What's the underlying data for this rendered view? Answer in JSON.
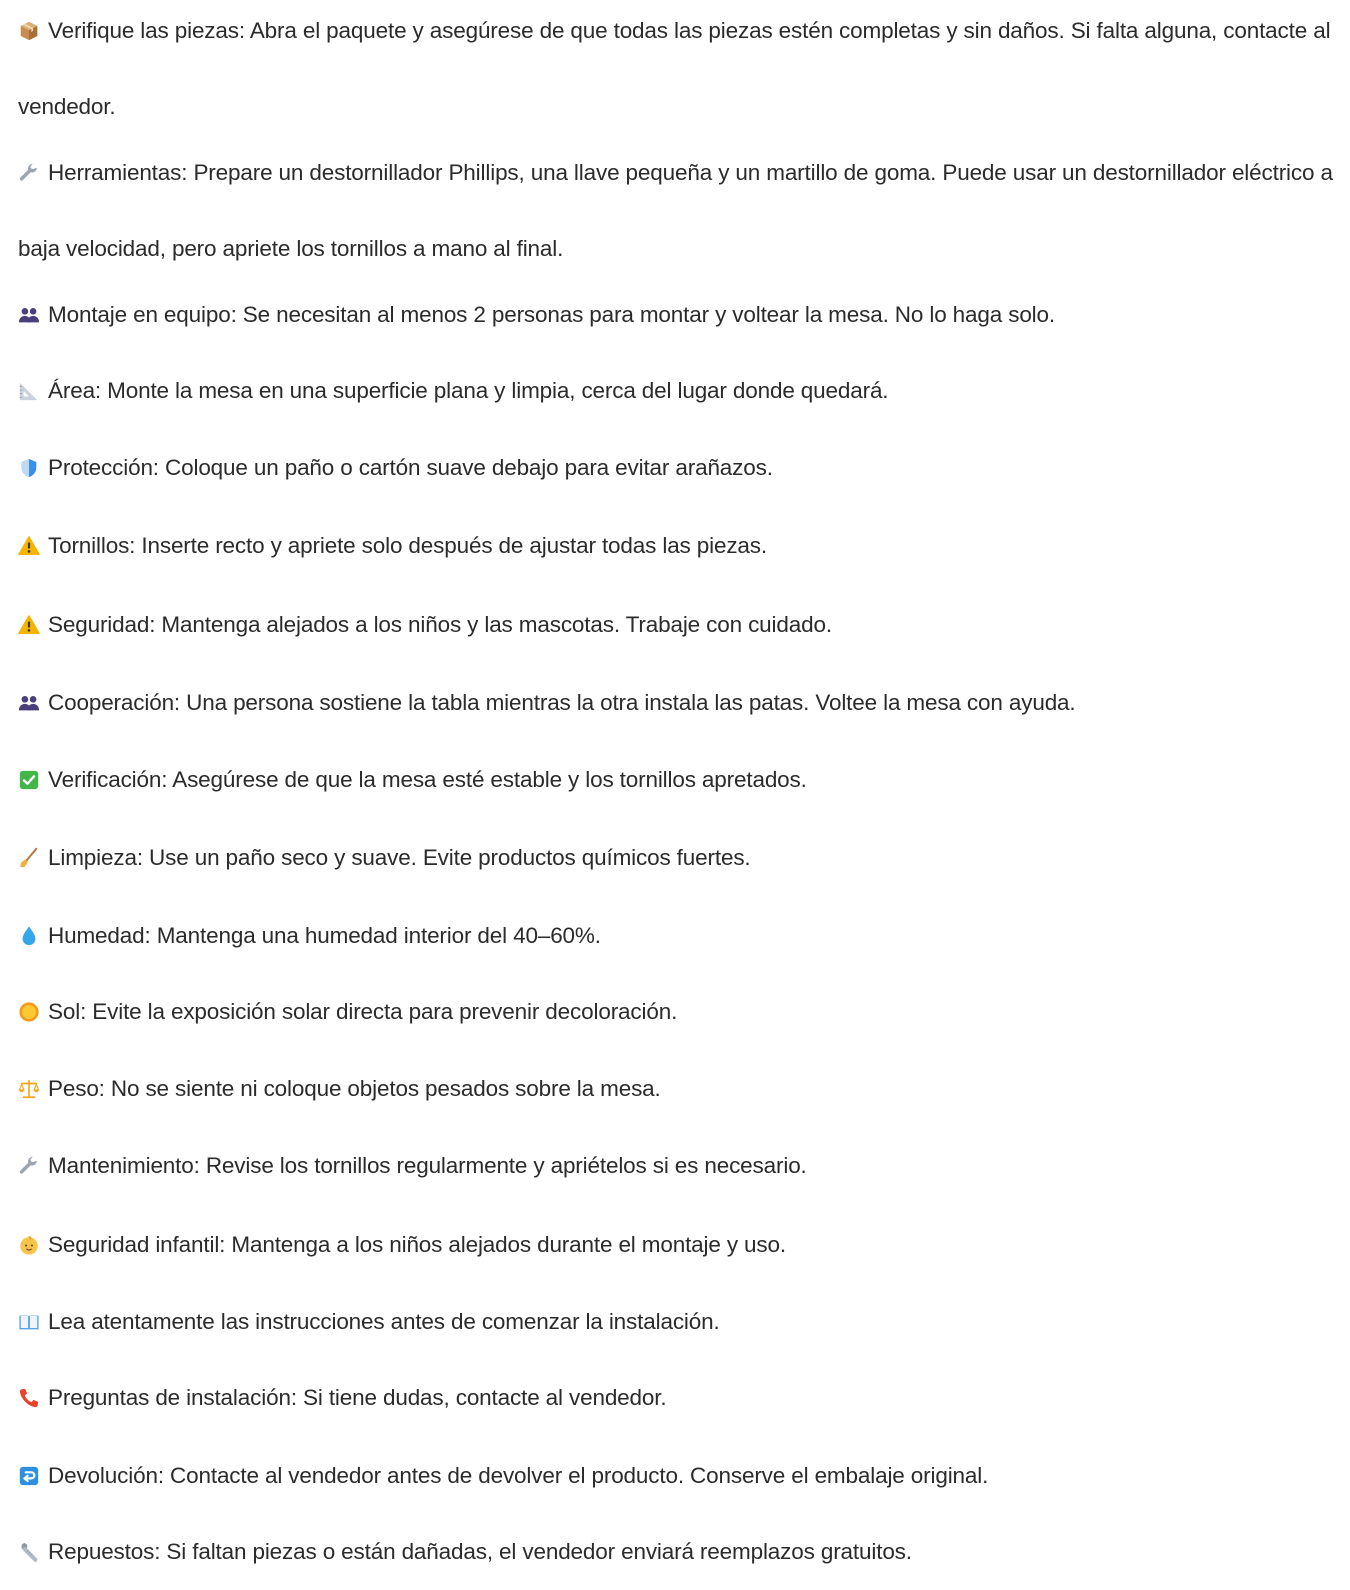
{
  "items": [
    {
      "icon": "package-icon",
      "text": "Verifique las piezas: Abra el paquete y asegúrese de que todas las piezas estén completas y sin daños. Si falta alguna, contacte al vendedor."
    },
    {
      "icon": "wrench-icon",
      "text": "Herramientas: Prepare un destornillador Phillips, una llave pequeña y un martillo de goma. Puede usar un destornillador eléctrico a baja velocidad, pero apriete los tornillos a mano al final."
    },
    {
      "icon": "people-icon",
      "text": "Montaje en equipo: Se necesitan al menos 2 personas para montar y voltear la mesa. No lo haga solo."
    },
    {
      "icon": "triangular-ruler-icon",
      "text": "Área: Monte la mesa en una superficie plana y limpia, cerca del lugar donde quedará."
    },
    {
      "icon": "shield-icon",
      "text": "Protección: Coloque un paño o cartón suave debajo para evitar arañazos."
    },
    {
      "icon": "warning-icon",
      "text": "Tornillos: Inserte recto y apriete solo después de ajustar todas las piezas."
    },
    {
      "icon": "warning-icon",
      "text": "Seguridad: Mantenga alejados a los niños y las mascotas. Trabaje con cuidado."
    },
    {
      "icon": "people-icon",
      "text": "Cooperación: Una persona sostiene la tabla mientras la otra instala las patas. Voltee la mesa con ayuda."
    },
    {
      "icon": "check-icon",
      "text": "Verificación: Asegúrese de que la mesa esté estable y los tornillos apretados."
    },
    {
      "icon": "broom-icon",
      "text": "Limpieza: Use un paño seco y suave. Evite productos químicos fuertes."
    },
    {
      "icon": "droplet-icon",
      "text": "Humedad: Mantenga una humedad interior del 40–60%."
    },
    {
      "icon": "sun-icon",
      "text": "Sol: Evite la exposición solar directa para prevenir decoloración."
    },
    {
      "icon": "scales-icon",
      "text": "Peso: No se siente ni coloque objetos pesados sobre la mesa."
    },
    {
      "icon": "wrench-icon",
      "text": "Mantenimiento: Revise los tornillos regularmente y apriételos si es necesario."
    },
    {
      "icon": "baby-icon",
      "text": "Seguridad infantil: Mantenga a los niños alejados durante el montaje y uso."
    },
    {
      "icon": "book-icon",
      "text": "Lea atentamente las instrucciones antes de comenzar la instalación."
    },
    {
      "icon": "phone-icon",
      "text": "Preguntas de instalación: Si tiene dudas, contacte al vendedor."
    },
    {
      "icon": "return-icon",
      "text": "Devolución: Contacte al vendedor antes de devolver el producto. Conserve el embalaje original."
    },
    {
      "icon": "nut-bolt-icon",
      "text": "Repuestos: Si faltan piezas o están dañadas, el vendedor enviará reemplazos gratuitos."
    }
  ]
}
